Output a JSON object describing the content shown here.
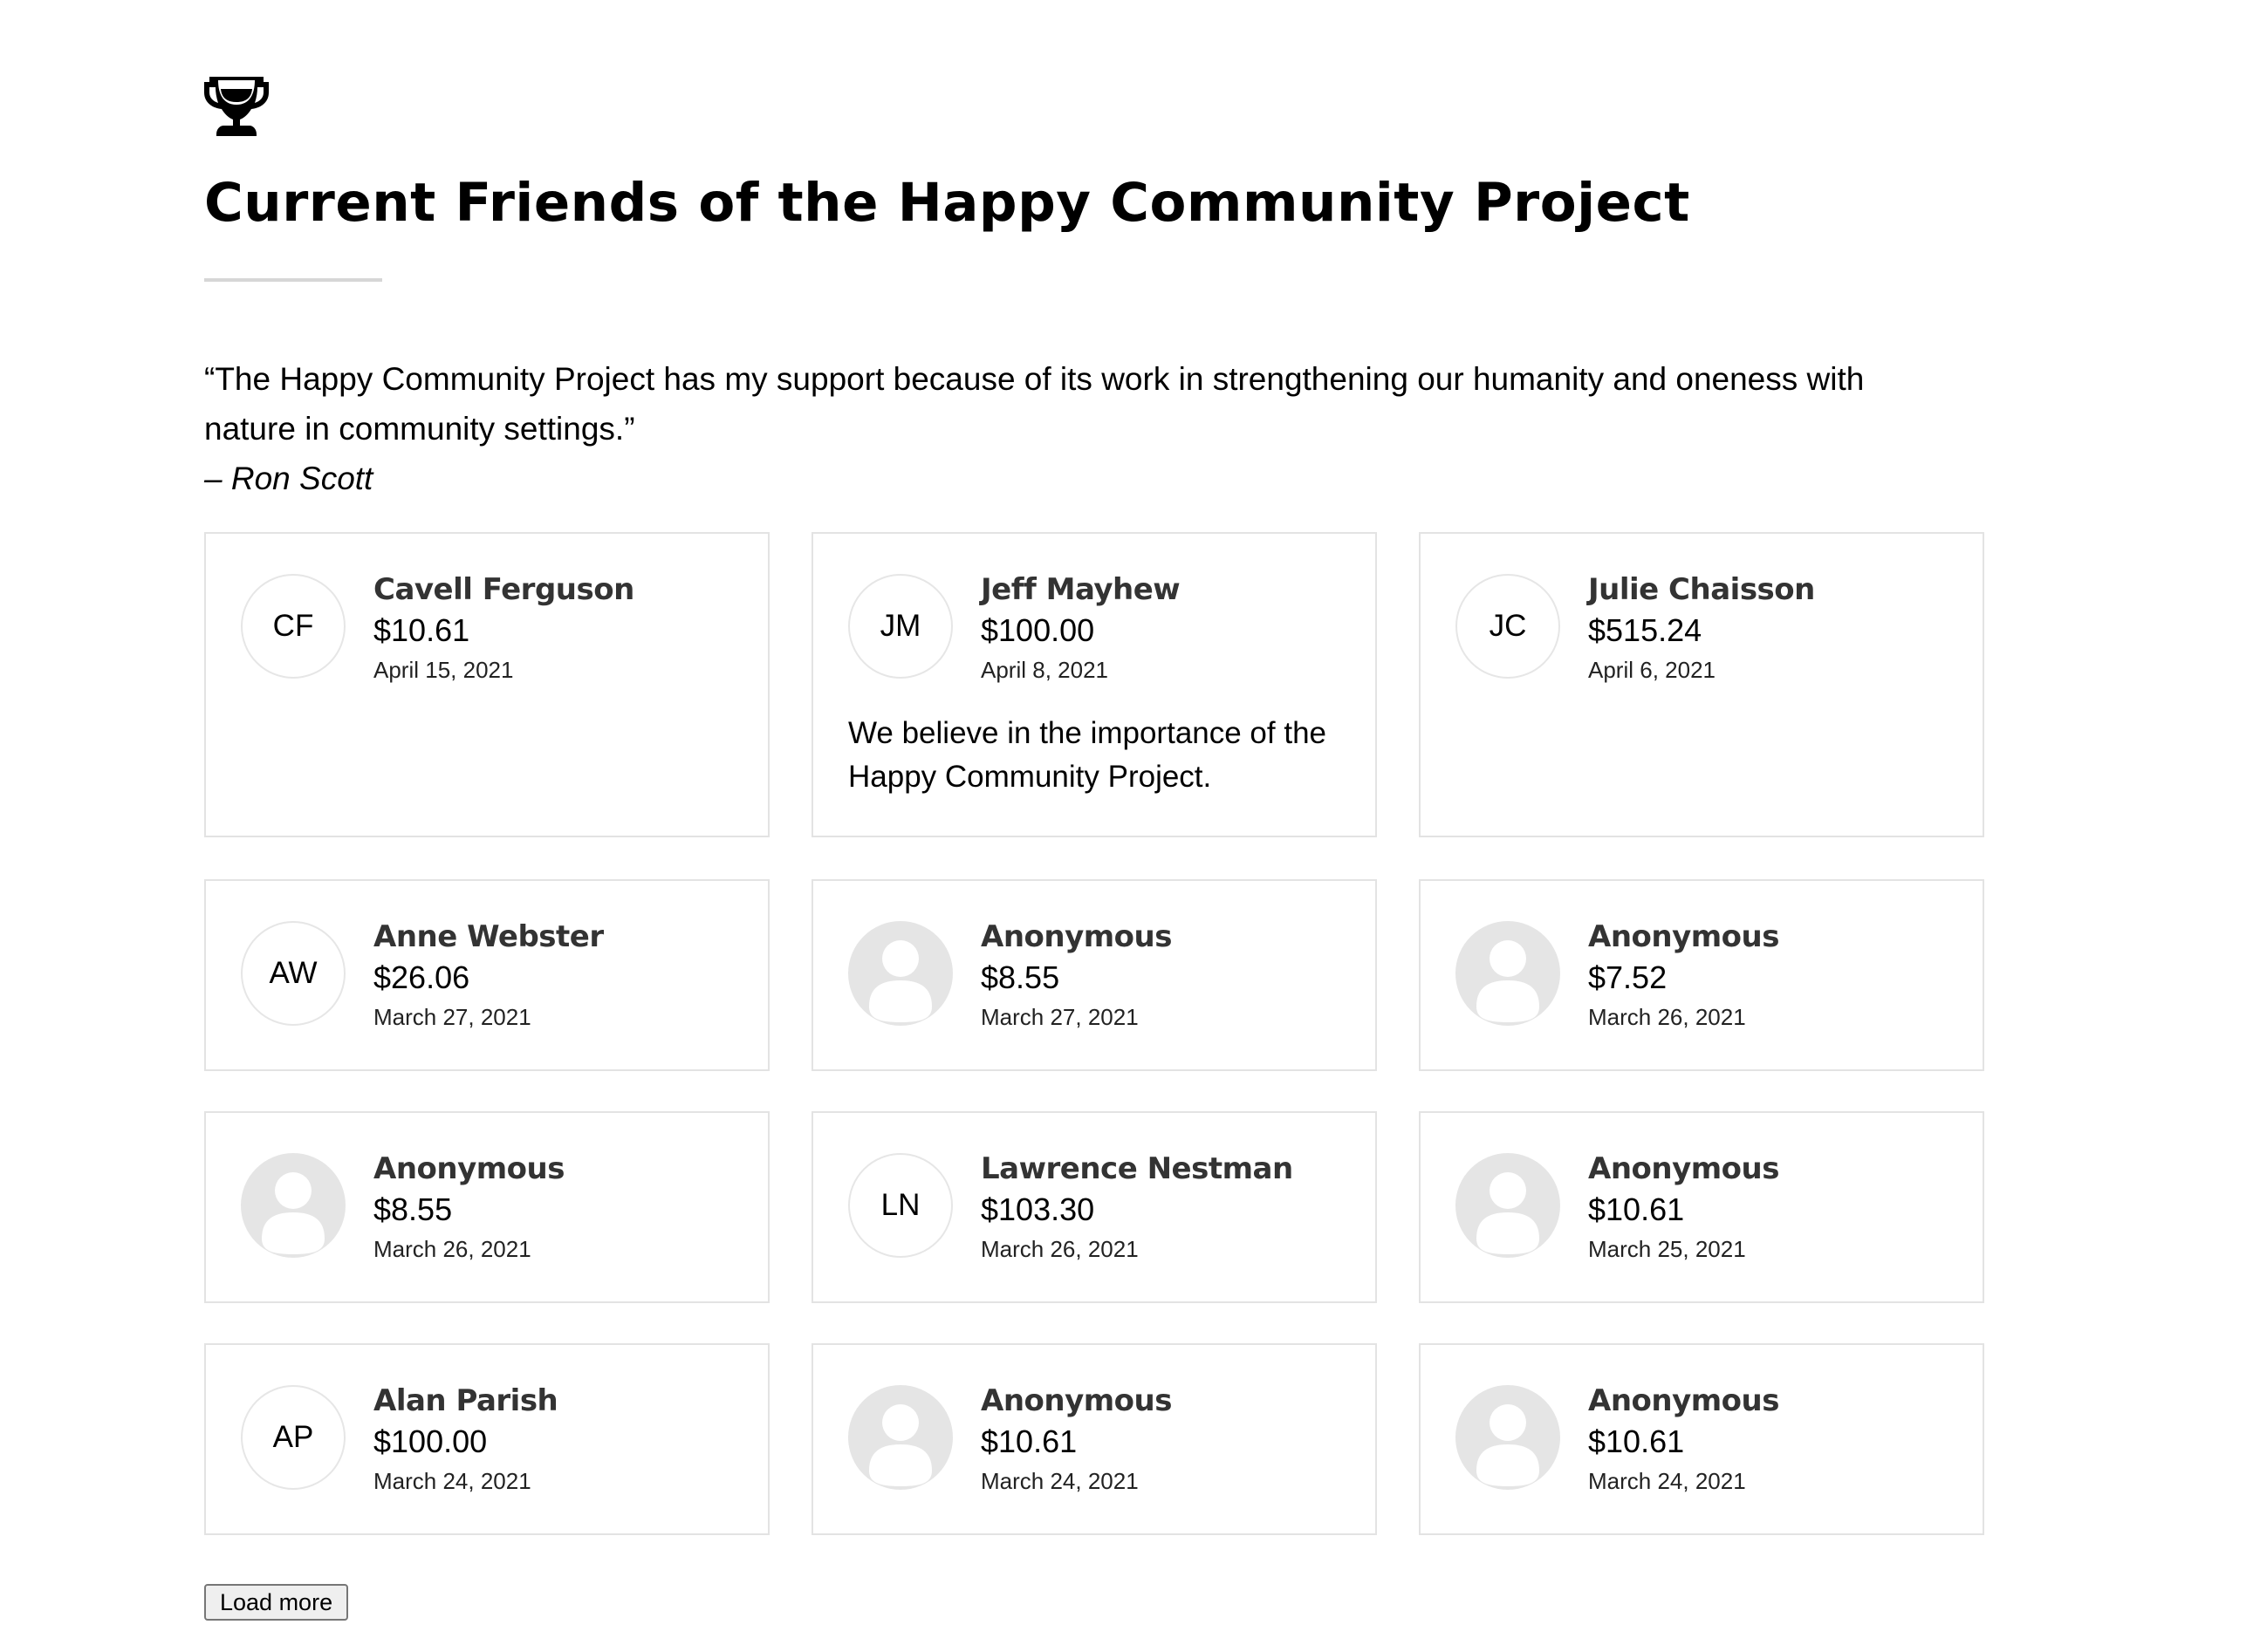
{
  "header": {
    "icon": "trophy-icon",
    "title": "Current Friends of the Happy Community Project"
  },
  "quote": {
    "text": "“The Happy Community Project has my support because of its work in strengthening our humanity and oneness with nature in community settings.”",
    "author": "– Ron Scott"
  },
  "donors": [
    {
      "initials": "CF",
      "name": "Cavell Ferguson",
      "amount": "$10.61",
      "date": "April 15, 2021",
      "message": "",
      "anonymous": false
    },
    {
      "initials": "JM",
      "name": "Jeff Mayhew",
      "amount": "$100.00",
      "date": "April 8, 2021",
      "message": "We believe in the importance of the Happy Community Project.",
      "anonymous": false
    },
    {
      "initials": "JC",
      "name": "Julie Chaisson",
      "amount": "$515.24",
      "date": "April 6, 2021",
      "message": "",
      "anonymous": false
    },
    {
      "initials": "AW",
      "name": "Anne Webster",
      "amount": "$26.06",
      "date": "March 27, 2021",
      "message": "",
      "anonymous": false
    },
    {
      "initials": "",
      "name": "Anonymous",
      "amount": "$8.55",
      "date": "March 27, 2021",
      "message": "",
      "anonymous": true
    },
    {
      "initials": "",
      "name": "Anonymous",
      "amount": "$7.52",
      "date": "March 26, 2021",
      "message": "",
      "anonymous": true
    },
    {
      "initials": "",
      "name": "Anonymous",
      "amount": "$8.55",
      "date": "March 26, 2021",
      "message": "",
      "anonymous": true
    },
    {
      "initials": "LN",
      "name": "Lawrence Nestman",
      "amount": "$103.30",
      "date": "March 26, 2021",
      "message": "",
      "anonymous": false
    },
    {
      "initials": "",
      "name": "Anonymous",
      "amount": "$10.61",
      "date": "March 25, 2021",
      "message": "",
      "anonymous": true
    },
    {
      "initials": "AP",
      "name": "Alan Parish",
      "amount": "$100.00",
      "date": "March 24, 2021",
      "message": "",
      "anonymous": false
    },
    {
      "initials": "",
      "name": "Anonymous",
      "amount": "$10.61",
      "date": "March 24, 2021",
      "message": "",
      "anonymous": true
    },
    {
      "initials": "",
      "name": "Anonymous",
      "amount": "$10.61",
      "date": "March 24, 2021",
      "message": "",
      "anonymous": true
    }
  ],
  "actions": {
    "load_more_label": "Load more"
  }
}
